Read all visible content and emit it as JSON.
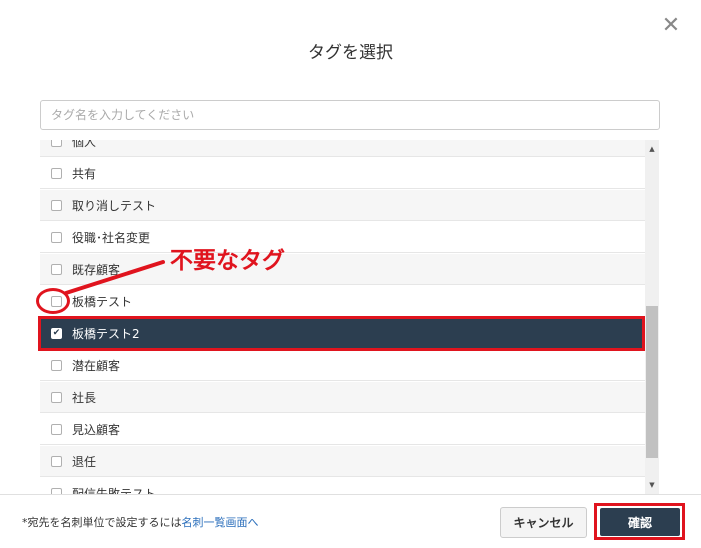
{
  "dialog": {
    "title": "タグを選択",
    "close_glyph": "✕"
  },
  "search": {
    "placeholder": "タグ名を入力してください",
    "value": ""
  },
  "tags": [
    {
      "label": "個人",
      "checked": false
    },
    {
      "label": "共有",
      "checked": false
    },
    {
      "label": "取り消しテスト",
      "checked": false
    },
    {
      "label": "役職･社名変更",
      "checked": false
    },
    {
      "label": "既存顧客",
      "checked": false
    },
    {
      "label": "板橋テスト",
      "checked": false
    },
    {
      "label": "板橋テスト2",
      "checked": true
    },
    {
      "label": "潜在顧客",
      "checked": false
    },
    {
      "label": "社長",
      "checked": false
    },
    {
      "label": "見込顧客",
      "checked": false
    },
    {
      "label": "退任",
      "checked": false
    },
    {
      "label": "配信失敗テスト",
      "checked": false
    }
  ],
  "footer": {
    "note_prefix": "*宛先を名刺単位で設定するには",
    "note_link": "名刺一覧画面へ",
    "cancel_label": "キャンセル",
    "confirm_label": "確認"
  },
  "annotation": {
    "label": "不要なタグ",
    "color": "#e0141e"
  },
  "icons": {
    "close": "close-icon",
    "check": "check-icon",
    "scroll_up": "triangle-up-icon",
    "scroll_down": "triangle-down-icon"
  },
  "scroll": {
    "thumb_start_fraction": 0.47,
    "thumb_size_fraction": 0.43
  },
  "colors": {
    "selected_row": "#2c3e50",
    "link": "#2a6ebb",
    "highlight": "#e0141e"
  }
}
